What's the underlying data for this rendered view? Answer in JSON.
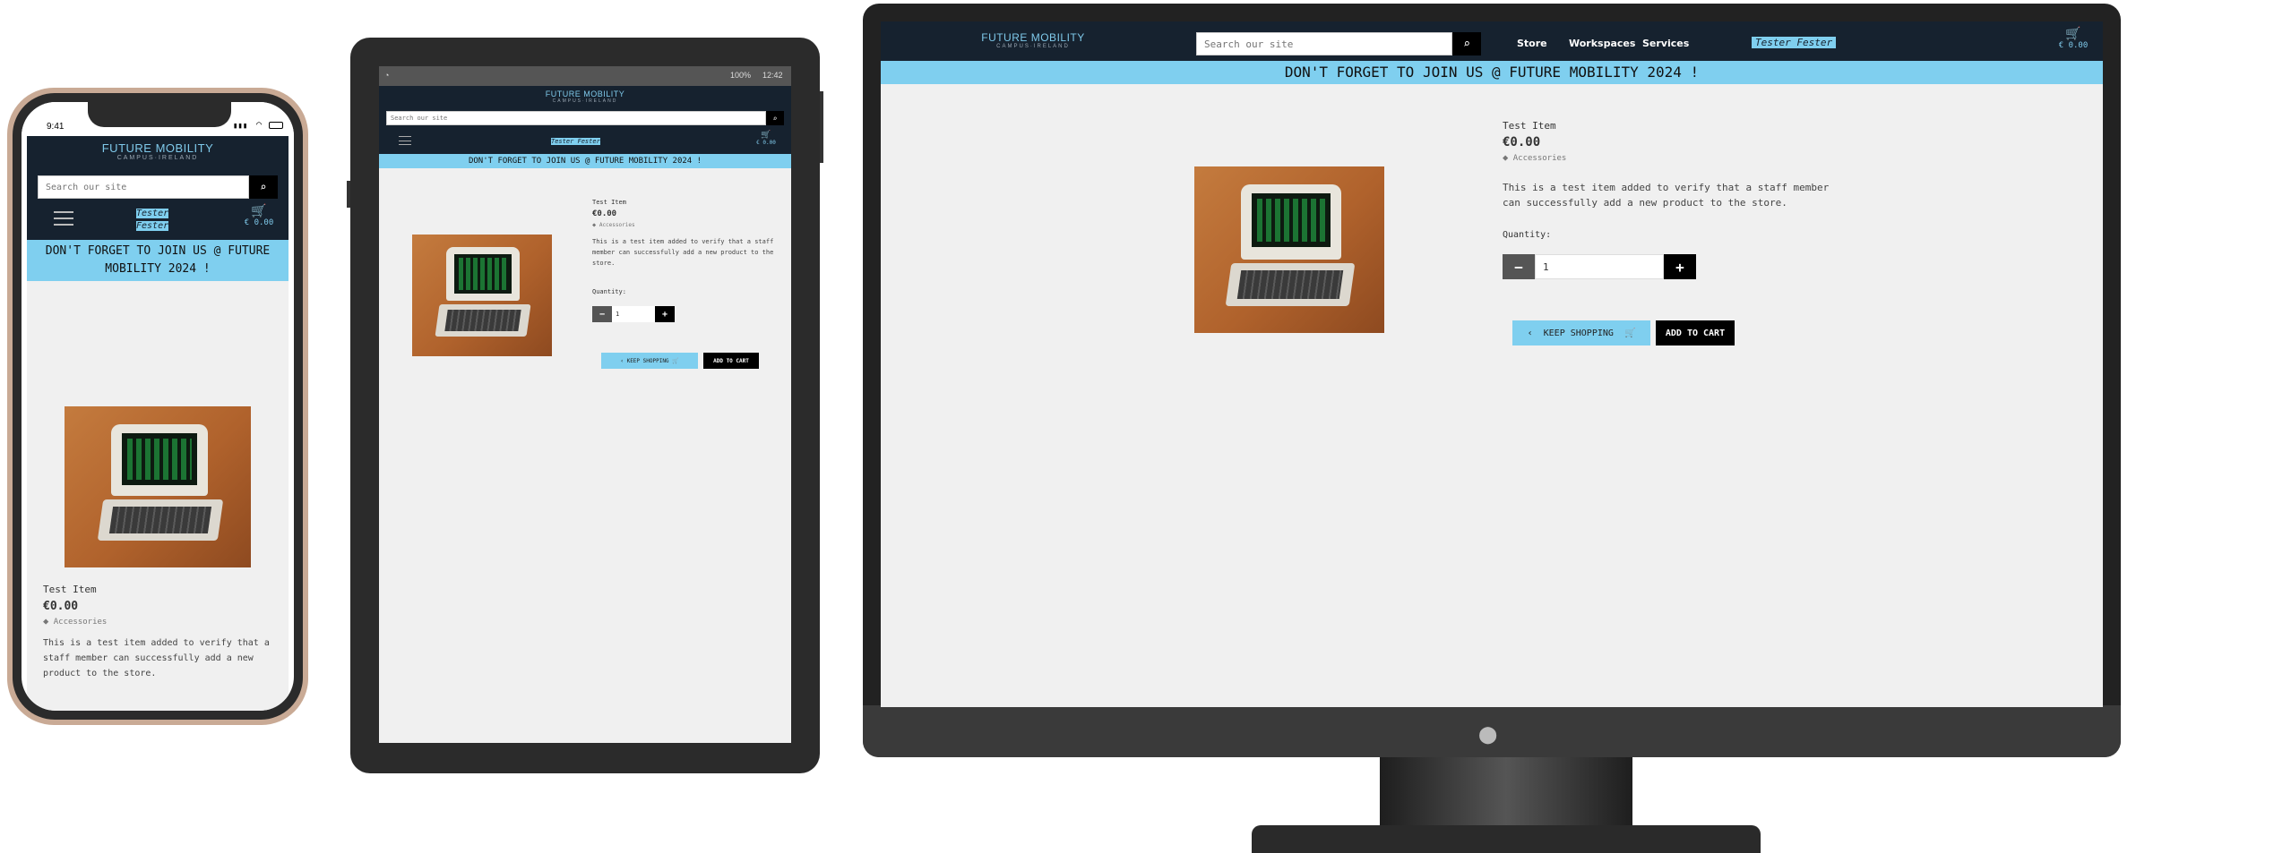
{
  "site": {
    "brand": "FUTURE MOBILITY",
    "brand_sub": "CAMPUS·IRELAND",
    "search_placeholder": "Search our site",
    "banner": "DON'T FORGET TO JOIN US @ FUTURE MOBILITY 2024 !",
    "user": "Tester Fester",
    "user_first": "Tester",
    "user_last": "Fester",
    "cart_total": "€ 0.00",
    "nav": [
      "Store",
      "Workspaces",
      "Services"
    ]
  },
  "product": {
    "name": "Test Item",
    "price": "€0.00",
    "category": "Accessories",
    "description": "This is a test item added to verify that a staff member can successfully add a new product to the store.",
    "quantity_label": "Quantity:",
    "quantity_value": "1",
    "keep_shopping": "KEEP SHOPPING",
    "add_to_cart": "ADD TO CART"
  },
  "phone_status": {
    "time": "9:41"
  },
  "tablet_status": {
    "battery": "100%",
    "time": "12:42"
  },
  "colors": {
    "accent": "#7fcfef",
    "header": "#16222f",
    "page": "#f0f0f0"
  }
}
